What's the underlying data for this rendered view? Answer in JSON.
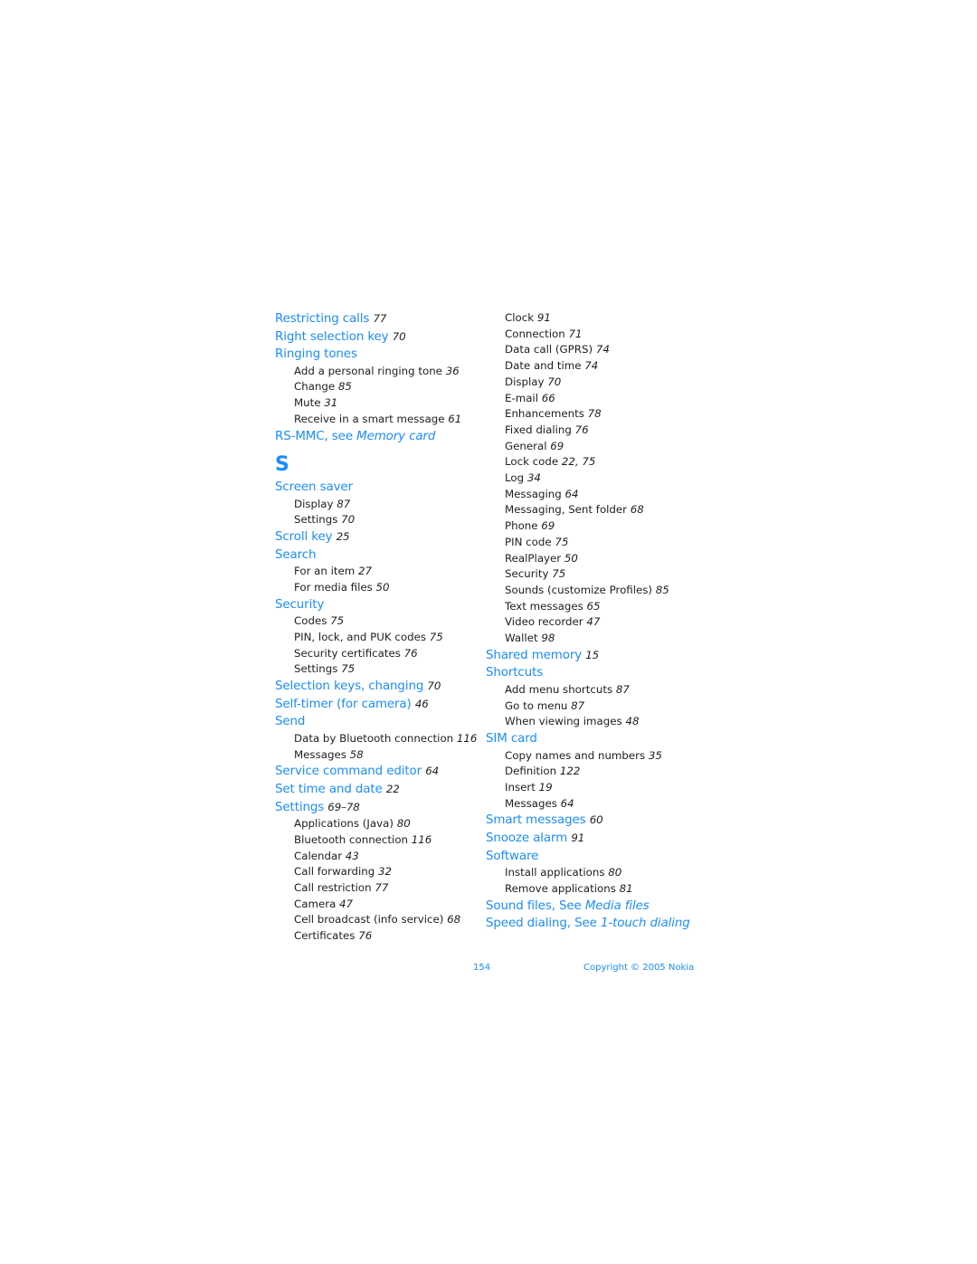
{
  "left_column": {
    "before_letter": [
      {
        "term": "Restricting calls",
        "page": "77",
        "subs": []
      },
      {
        "term": "Right selection key",
        "page": "70",
        "subs": []
      },
      {
        "term": "Ringing tones",
        "page": "",
        "subs": [
          {
            "term": "Add a personal ringing tone",
            "page": "36"
          },
          {
            "term": "Change",
            "page": "85"
          },
          {
            "term": "Mute",
            "page": "31"
          },
          {
            "term": "Receive in a smart message",
            "page": "61"
          }
        ]
      },
      {
        "term": "RS-MMC, see ",
        "ref": "Memory card",
        "page": "",
        "subs": []
      }
    ],
    "letter": "S",
    "after_letter": [
      {
        "term": "Screen saver",
        "page": "",
        "subs": [
          {
            "term": "Display",
            "page": "87"
          },
          {
            "term": "Settings",
            "page": "70"
          }
        ]
      },
      {
        "term": "Scroll key",
        "page": "25",
        "subs": []
      },
      {
        "term": "Search",
        "page": "",
        "subs": [
          {
            "term": "For an item",
            "page": "27"
          },
          {
            "term": "For media files",
            "page": "50"
          }
        ]
      },
      {
        "term": "Security",
        "page": "",
        "subs": [
          {
            "term": "Codes",
            "page": "75"
          },
          {
            "term": "PIN, lock, and PUK codes",
            "page": "75"
          },
          {
            "term": "Security certificates",
            "page": "76"
          },
          {
            "term": "Settings",
            "page": "75"
          }
        ]
      },
      {
        "term": "Selection keys, changing",
        "page": "70",
        "subs": []
      },
      {
        "term": "Self-timer (for camera)",
        "page": "46",
        "subs": []
      },
      {
        "term": "Send",
        "page": "",
        "subs": [
          {
            "term": "Data by Bluetooth connection",
            "page": "116"
          },
          {
            "term": "Messages",
            "page": "58"
          }
        ]
      },
      {
        "term": "Service command editor",
        "page": "64",
        "subs": []
      },
      {
        "term": "Set time and date",
        "page": "22",
        "subs": []
      },
      {
        "term": "Settings",
        "page": "69–78",
        "subs": [
          {
            "term": "Applications (Java)",
            "page": "80"
          },
          {
            "term": "Bluetooth connection",
            "page": "116"
          },
          {
            "term": "Calendar",
            "page": "43"
          },
          {
            "term": "Call forwarding",
            "page": "32"
          },
          {
            "term": "Call restriction",
            "page": "77"
          },
          {
            "term": "Camera",
            "page": "47"
          },
          {
            "term": "Cell broadcast (info service)",
            "page": "68"
          },
          {
            "term": "Certificates",
            "page": "76"
          }
        ]
      }
    ]
  },
  "right_column": {
    "continued_subs": [
      {
        "term": "Clock",
        "page": "91"
      },
      {
        "term": "Connection",
        "page": "71"
      },
      {
        "term": "Data call (GPRS)",
        "page": "74"
      },
      {
        "term": "Date and time",
        "page": "74"
      },
      {
        "term": "Display",
        "page": "70"
      },
      {
        "term": "E-mail",
        "page": "66"
      },
      {
        "term": "Enhancements",
        "page": "78"
      },
      {
        "term": "Fixed dialing",
        "page": "76"
      },
      {
        "term": "General",
        "page": "69"
      },
      {
        "term": "Lock code",
        "page": "22, 75"
      },
      {
        "term": "Log",
        "page": "34"
      },
      {
        "term": "Messaging",
        "page": "64"
      },
      {
        "term": "Messaging, Sent folder",
        "page": "68"
      },
      {
        "term": "Phone",
        "page": "69"
      },
      {
        "term": "PIN code",
        "page": "75"
      },
      {
        "term": "RealPlayer",
        "page": "50"
      },
      {
        "term": "Security",
        "page": "75"
      },
      {
        "term": "Sounds (customize Profiles)",
        "page": "85"
      },
      {
        "term": "Text messages",
        "page": "65"
      },
      {
        "term": "Video recorder",
        "page": "47"
      },
      {
        "term": "Wallet",
        "page": "98"
      }
    ],
    "entries": [
      {
        "term": "Shared memory",
        "page": "15",
        "subs": []
      },
      {
        "term": "Shortcuts",
        "page": "",
        "subs": [
          {
            "term": "Add menu shortcuts",
            "page": "87"
          },
          {
            "term": "Go to menu",
            "page": "87"
          },
          {
            "term": "When viewing images",
            "page": "48"
          }
        ]
      },
      {
        "term": "SIM card",
        "page": "",
        "subs": [
          {
            "term": "Copy names and numbers",
            "page": "35"
          },
          {
            "term": "Definition",
            "page": "122"
          },
          {
            "term": "Insert",
            "page": "19"
          },
          {
            "term": "Messages",
            "page": "64"
          }
        ]
      },
      {
        "term": "Smart messages",
        "page": "60",
        "subs": []
      },
      {
        "term": "Snooze alarm",
        "page": "91",
        "subs": []
      },
      {
        "term": "Software",
        "page": "",
        "subs": [
          {
            "term": "Install applications",
            "page": "80"
          },
          {
            "term": "Remove applications",
            "page": "81"
          }
        ]
      },
      {
        "term": "Sound files, See ",
        "ref": "Media files",
        "page": "",
        "subs": []
      },
      {
        "term": "Speed dialing, See ",
        "ref": "1-touch dialing",
        "page": "",
        "subs": []
      }
    ]
  },
  "footer": {
    "page_number": "154",
    "copyright": "Copyright © 2005 Nokia"
  }
}
